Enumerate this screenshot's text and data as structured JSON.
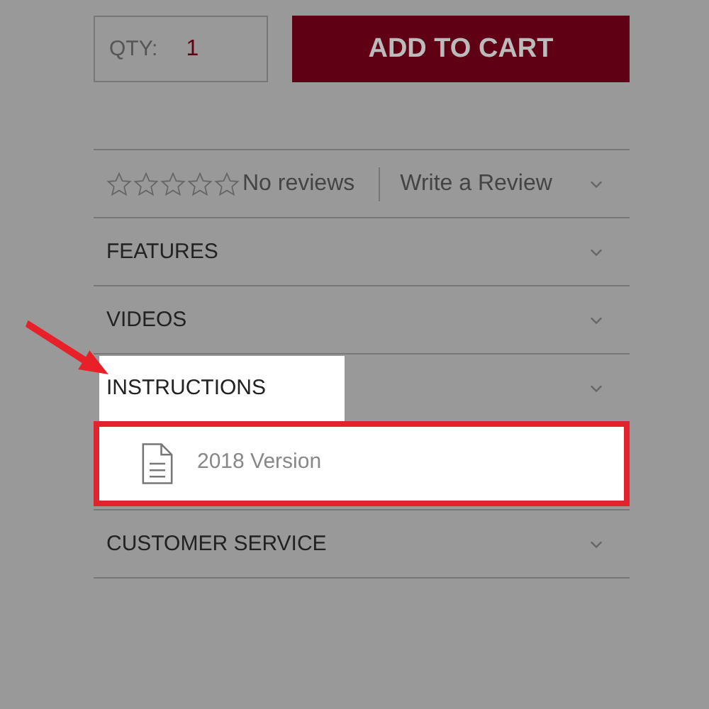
{
  "quantity": {
    "label": "QTY:",
    "value": "1"
  },
  "add_to_cart": "ADD TO CART",
  "reviews": {
    "stars": 0,
    "summary": "No reviews",
    "link": "Write a Review"
  },
  "sections": [
    {
      "title": "FEATURES",
      "highlighted": false
    },
    {
      "title": "VIDEOS",
      "highlighted": false
    },
    {
      "title": "INSTRUCTIONS",
      "highlighted": true,
      "files": [
        {
          "name": "2018 Version",
          "highlighted": true
        }
      ]
    },
    {
      "title": "CUSTOMER SERVICE",
      "highlighted": false
    }
  ]
}
